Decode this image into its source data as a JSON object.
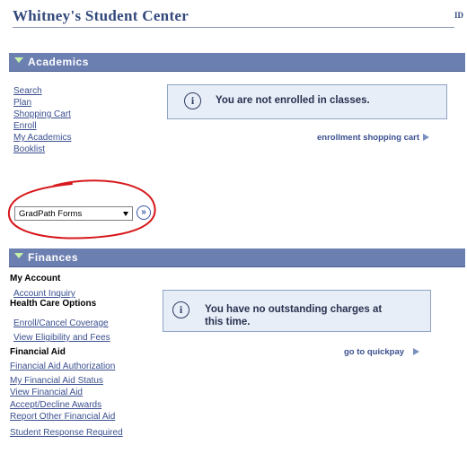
{
  "header": {
    "title": "Whitney's Student Center",
    "id_label": "ID"
  },
  "academics": {
    "title": "Academics",
    "links": [
      "Search",
      "Plan",
      "Shopping Cart",
      "Enroll",
      "My Academics",
      "Booklist"
    ],
    "notice": "You are not enrolled in classes.",
    "cart_link": "enrollment shopping cart",
    "dropdown_value": "GradPath Forms"
  },
  "finances": {
    "title": "Finances",
    "my_account": {
      "heading": "My Account",
      "links": [
        "Account Inquiry"
      ]
    },
    "health": {
      "heading": "Health Care Options",
      "links": [
        "Enroll/Cancel Coverage",
        "View Eligibility and Fees"
      ]
    },
    "aid": {
      "heading": "Financial Aid",
      "links": [
        "Financial Aid Authorization",
        "My Financial Aid Status",
        "View Financial Aid",
        "Accept/Decline Awards",
        "Report Other Financial Aid"
      ]
    },
    "student_response": "Student Response Required",
    "notice_line1": "You have no outstanding charges at",
    "notice_line2": "this time.",
    "quickpay_link": "go to quickpay"
  },
  "icons": {
    "info": "info-icon",
    "expand": "triangle-down-icon",
    "go": "double-chevron-right-icon",
    "play": "play-arrow-icon"
  },
  "colors": {
    "section_bar": "#6c7fb1",
    "link": "#3a4f8f",
    "annotation_circle": "#d7191c"
  }
}
